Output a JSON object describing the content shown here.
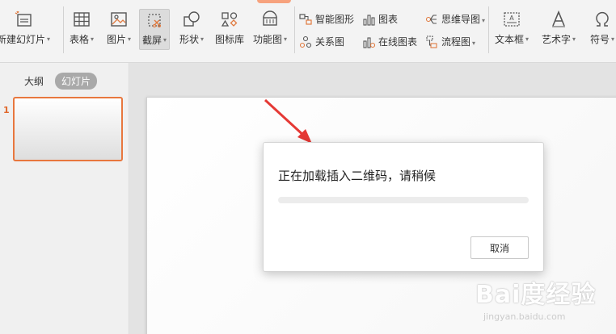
{
  "toolbar": {
    "new_slide": "新建幻灯片",
    "table": "表格",
    "picture": "图片",
    "screenshot": "截屏",
    "shape": "形状",
    "icon_library": "图标库",
    "function_chart": "功能图",
    "smart_shape": "智能图形",
    "relation_chart": "关系图",
    "chart": "图表",
    "online_chart": "在线图表",
    "mind_map": "思维导图",
    "flowchart": "流程图",
    "text_box": "文本框",
    "word_art": "艺术字",
    "symbol": "符号",
    "icons": {
      "new_slide": "new-slide-icon",
      "table": "table-icon",
      "picture": "picture-icon",
      "screenshot": "screenshot-icon",
      "shape": "shape-icon",
      "icon_library": "icon-library-icon",
      "function_chart": "function-chart-icon",
      "smart_shape": "smart-shape-icon",
      "relation_chart": "relation-chart-icon",
      "chart": "chart-icon",
      "online_chart": "online-chart-icon",
      "mind_map": "mind-map-icon",
      "flowchart": "flowchart-icon",
      "text_box": "text-box-icon",
      "word_art": "word-art-icon",
      "symbol": "symbol-icon"
    }
  },
  "left_panel": {
    "tab_outline": "大纲",
    "tab_slides": "幻灯片",
    "slide_number": "1"
  },
  "dialog": {
    "message": "正在加载插入二维码，请稍候",
    "cancel_label": "取消",
    "progress": 0
  },
  "watermark": {
    "brand": "Bai度经验",
    "url": "jingyan.baidu.com"
  },
  "colors": {
    "accent": "#e8773e",
    "arrow": "#e53935",
    "ribbon_bg": "#f3f3f3",
    "icon_orange": "#e07a3f"
  }
}
